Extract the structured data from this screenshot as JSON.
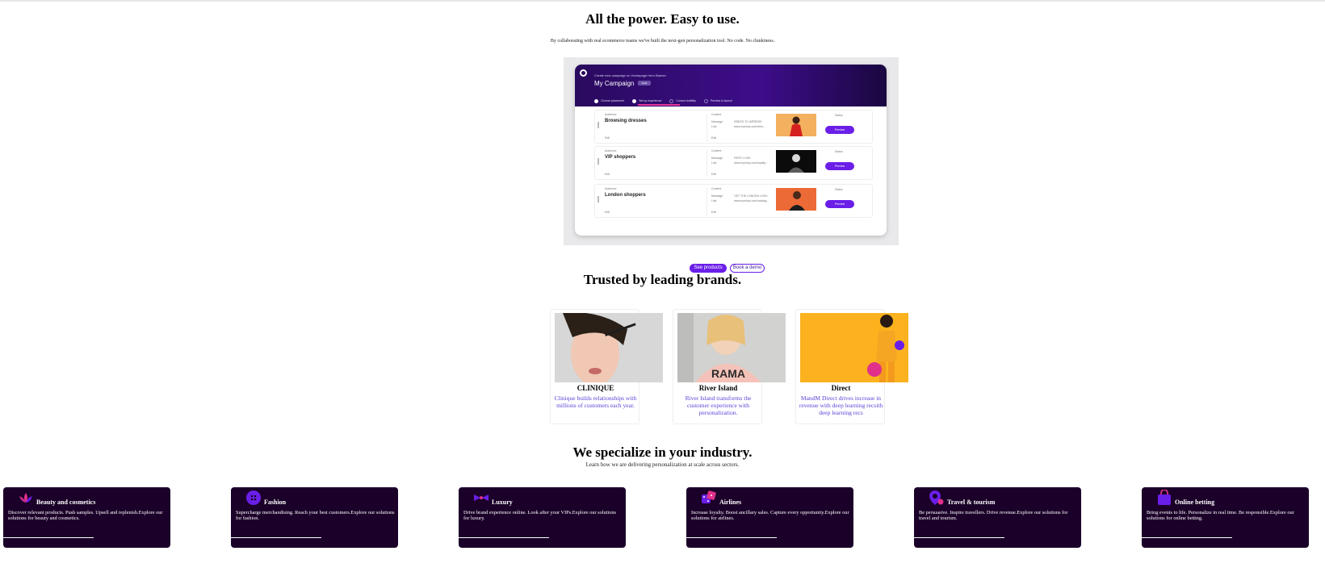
{
  "hero": {
    "title": "All the power. Easy to use.",
    "subtitle": "By collaborating with real ecommerce teams we've built the next-gen personalization tool. No code. No clunkiness.",
    "mock": {
      "small_title": "Create new campaign on Homepage Hero Banner",
      "campaign_name": "My Campaign",
      "badge": "Draft",
      "steps": [
        "Choose placement",
        "Set up experience",
        "Control visibility",
        "Preview & launch"
      ],
      "rows": [
        {
          "audience_label": "Audience",
          "name": "Browsing dresses",
          "content_label": "Content",
          "message_label": "Message",
          "message": "DRESS TO IMPRESS",
          "link_label": "Link",
          "link": "www.myshop.com/dres...",
          "edit": "Edit",
          "status": "Status",
          "preview": "Preview"
        },
        {
          "audience_label": "Audience",
          "name": "VIP shoppers",
          "content_label": "Content",
          "message_label": "Message",
          "message": "FIRST LOOK",
          "link_label": "Link",
          "link": "www.myshop.com/loyalty...",
          "edit": "Edit",
          "status": "Status",
          "preview": "Preview"
        },
        {
          "audience_label": "Audience",
          "name": "London shoppers",
          "content_label": "Content",
          "message_label": "Message",
          "message": "GET THE LONDON LOOK",
          "link_label": "Link",
          "link": "www.myshop.com/catalog...",
          "edit": "Edit",
          "status": "Status",
          "preview": "Preview"
        }
      ]
    },
    "cta_primary": "See products",
    "cta_secondary": "Book a demo"
  },
  "brands": {
    "title": "Trusted by leading brands.",
    "cards": [
      {
        "name": "CLINIQUE",
        "desc": "Clinique builds relationships with millions of customers each year."
      },
      {
        "name": "River Island",
        "desc": "River Island transforms the customer experience with personalization."
      },
      {
        "name": "Direct",
        "desc": "MandM Direct drives increase in revenue with deep learning recsith deep learning recs"
      }
    ]
  },
  "industries": {
    "title": "We specialize in your industry.",
    "subtitle": "Learn how we are delivering personalization at scale across sectors.",
    "cards": [
      {
        "icon": "lotus-icon",
        "title": "Beauty and cosmetics",
        "desc": "Discover relevant products. Push samples. Upsell and replenish.Explore our solutions for beauty and cosmetics."
      },
      {
        "icon": "button-icon",
        "title": "Fashion",
        "desc": "Supercharge merchandising. Reach your best customers.Explore our solutions for fashion."
      },
      {
        "icon": "bow-tie-icon",
        "title": "Luxury",
        "desc": "Drive brand experience online. Look after your VIPs.Explore our solutions for luxury."
      },
      {
        "icon": "dice-icon",
        "title": "Airlines",
        "desc": "Increase loyalty. Boost ancillary sales. Capture every opportunity.Explore our solutions for airlines."
      },
      {
        "icon": "location-pin-icon",
        "title": "Travel & tourism",
        "desc": "Be persuasive. Inspire travellers. Drive revenue.Explore our solutions for travel and tourism."
      },
      {
        "icon": "shopping-bag-icon",
        "title": "Online betting",
        "desc": "Bring events to life. Personalize in real time. Be responsible.Explore our solutions for online betting."
      }
    ]
  },
  "colors": {
    "accent": "#6a1ee8",
    "card_dark": "#1b0029",
    "brand_desc": "#5b3fd6"
  }
}
